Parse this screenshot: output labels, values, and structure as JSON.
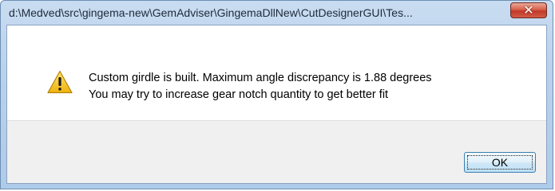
{
  "window": {
    "title": "d:\\Medved\\src\\gingema-new\\GemAdviser\\GingemaDllNew\\CutDesignerGUI\\Tes...",
    "close_label": "✕"
  },
  "message": {
    "line1": "Custom girdle is built. Maximum angle discrepancy is  1.88 degrees",
    "line2": "You may try to increase gear notch quantity to get better fit",
    "icon": "warning-icon"
  },
  "buttons": {
    "ok_label": "OK"
  },
  "colors": {
    "titlebar": "#b9d1ec",
    "close_button": "#c1382a",
    "warning_yellow": "#f7c51c",
    "footer": "#f0f0f0"
  }
}
